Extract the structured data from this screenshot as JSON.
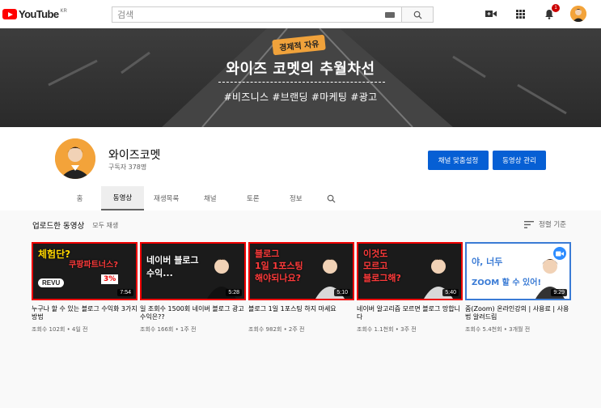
{
  "header": {
    "logo_text": "YouTube",
    "logo_country": "KR",
    "search_placeholder": "검색",
    "notification_count": "1"
  },
  "banner": {
    "tag": "경제적 자유",
    "title": "와이즈 코멧의 추월차선",
    "hashtags": "#비즈니스 #브랜딩 #마케팅 #광고"
  },
  "channel": {
    "name": "와이즈코멧",
    "subscribers": "구독자 378명",
    "customize_button": "채널 맞춤설정",
    "manage_button": "동영상 관리",
    "tabs": [
      "홈",
      "동영상",
      "재생목록",
      "채널",
      "토론",
      "정보"
    ],
    "active_tab": "동영상"
  },
  "section": {
    "title": "업로드한 동영상",
    "play_all": "모두 재생",
    "sort_label": "정렬 기준"
  },
  "videos": [
    {
      "title": "누구나 할 수 있는 블로그 수익화 3가지 방법",
      "meta": "조회수 102회 • 4일 전",
      "duration": "7:54",
      "thumb_lines": [
        "체험단?",
        "쿠팡파트너스?"
      ],
      "thumb_extra": "3%",
      "thumb_logo": "REVU"
    },
    {
      "title": "일 조회수 1500회 네이버 블로그 광고 수익은??",
      "meta": "조회수 166회 • 1주 전",
      "duration": "5:28",
      "thumb_lines": [
        "네이버 블로그",
        "수익..."
      ]
    },
    {
      "title": "블로그 1일 1포스팅 하지 마세요",
      "meta": "조회수 982회 • 2주 전",
      "duration": "5:10",
      "thumb_lines": [
        "블로그",
        "1일 1포스팅",
        "해야되나요?"
      ]
    },
    {
      "title": "네이버 알고리즘 모르면 블로그 망합니다",
      "meta": "조회수 1.1천회 • 3주 전",
      "duration": "5:40",
      "thumb_lines": [
        "이것도",
        "모르고",
        "블로그해?"
      ]
    },
    {
      "title": "줌(Zoom) 온라인강의 | 사용료 | 사용법 알려드림",
      "meta": "조회수 5.4천회 • 3개월 전",
      "duration": "9:29",
      "thumb_lines": [
        "야, 너두",
        "ZOOM 할 수 있어!"
      ]
    }
  ],
  "colors": {
    "brand_red": "#ff0000",
    "button_blue": "#065fd4",
    "thumb_border_red": "#e00000",
    "thumb_border_blue": "#3a7bd5"
  }
}
